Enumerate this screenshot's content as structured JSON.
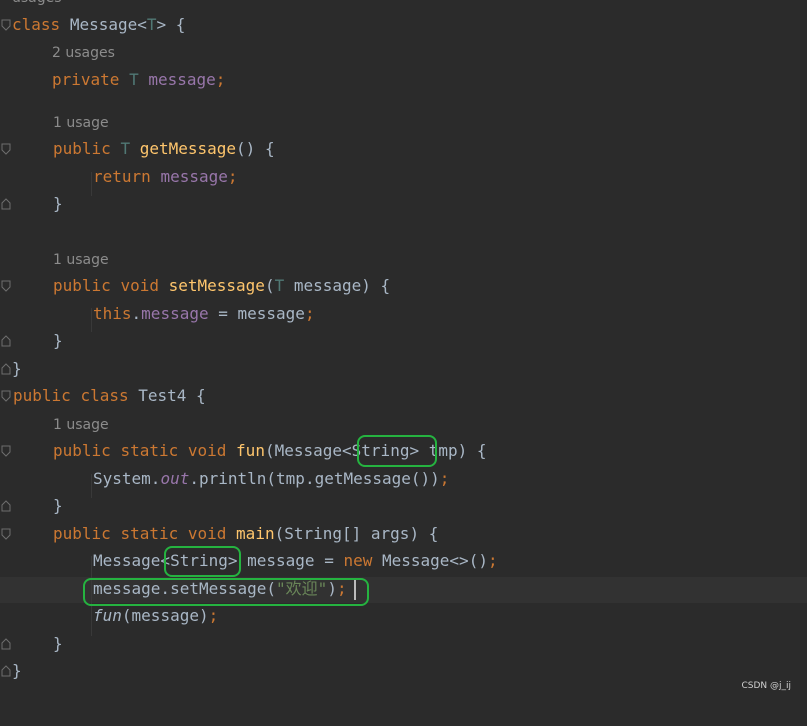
{
  "editor": {
    "top_hint": "usages",
    "lines": {
      "l1": {
        "kw": "class",
        "name": "Message",
        "lt": "<",
        "tp": "T",
        "rest": "> {"
      },
      "h1": "2 usages",
      "l2": {
        "kw": "private",
        "tp": "T",
        "field": "message",
        "semi": ";"
      },
      "h2": "1 usage",
      "l3": {
        "kw": "public",
        "tp": "T",
        "fn": "getMessage",
        "rest": "() {"
      },
      "l4": {
        "kw": "return",
        "field": "message",
        "semi": ";"
      },
      "l5": {
        "text": "}"
      },
      "h3": "1 usage",
      "l6": {
        "kw1": "public",
        "kw2": "void",
        "fn": "setMessage",
        "open": "(",
        "tp": "T",
        "rest": " message) {"
      },
      "l7": {
        "kw": "this",
        "dot": ".",
        "field": "message",
        "rest": " = message",
        "semi": ";"
      },
      "l8": {
        "text": "}"
      },
      "l9": {
        "text": "}"
      },
      "l10": {
        "kw1": "public",
        "kw2": "class",
        "rest": "Test4 {"
      },
      "h4": "1 usage",
      "l11": {
        "kw1": "public",
        "kw2": "static",
        "kw3": "void",
        "fn": "fun",
        "pre": "(Message<",
        "generic": "String",
        "post": "> tmp) {"
      },
      "l12": {
        "pre": "System.",
        "field": "out",
        "post": ".println(tmp.getMessage())",
        "semi": ";"
      },
      "l13": {
        "text": "}"
      },
      "l14": {
        "kw1": "public",
        "kw2": "static",
        "kw3": "void",
        "fn": "main",
        "rest": "(String[] args) {"
      },
      "l15": {
        "pre": "Message<",
        "generic": "String",
        "mid": "> message = ",
        "kw": "new",
        "post": " Message<>()",
        "semi": ";"
      },
      "l16": {
        "pre": "message.setMessage(",
        "str": "\"欢迎\"",
        "post": ")",
        "semi": ";"
      },
      "l17": {
        "fn": "fun",
        "post": "(message)",
        "semi": ";"
      },
      "l18": {
        "text": "}"
      },
      "l19": {
        "text": "}"
      }
    }
  },
  "watermark": "CSDN @j_ij",
  "colors": {
    "background": "#2b2b2b",
    "keyword": "#cc7832",
    "type_param": "#507874",
    "field": "#9876aa",
    "method": "#ffc66d",
    "string": "#6a8759",
    "highlight_box": "#25b340"
  }
}
